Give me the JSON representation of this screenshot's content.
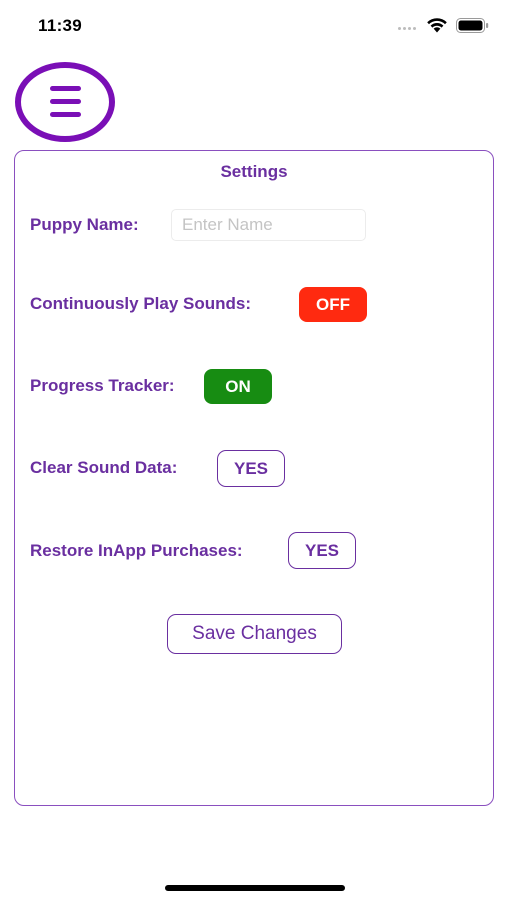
{
  "status_bar": {
    "time": "11:39",
    "signal_icon": "cellular-signal-icon",
    "wifi_icon": "wifi-icon",
    "battery_icon": "battery-icon"
  },
  "menu": {
    "icon": "hamburger-menu-icon",
    "color": "#7a0fb6"
  },
  "settings": {
    "title": "Settings",
    "puppy_name_label": "Puppy Name:",
    "puppy_name_value": "",
    "puppy_name_placeholder": "Enter Name",
    "play_sounds_label": "Continuously Play Sounds:",
    "play_sounds_state": "OFF",
    "progress_tracker_label": "Progress Tracker:",
    "progress_tracker_state": "ON",
    "clear_data_label": "Clear Sound Data:",
    "clear_data_button": "YES",
    "restore_purchases_label": "Restore InApp Purchases:",
    "restore_purchases_button": "YES",
    "save_button": "Save Changes"
  },
  "colors": {
    "accent": "#6a2fa0",
    "off": "#ff2a10",
    "on": "#178c12"
  }
}
